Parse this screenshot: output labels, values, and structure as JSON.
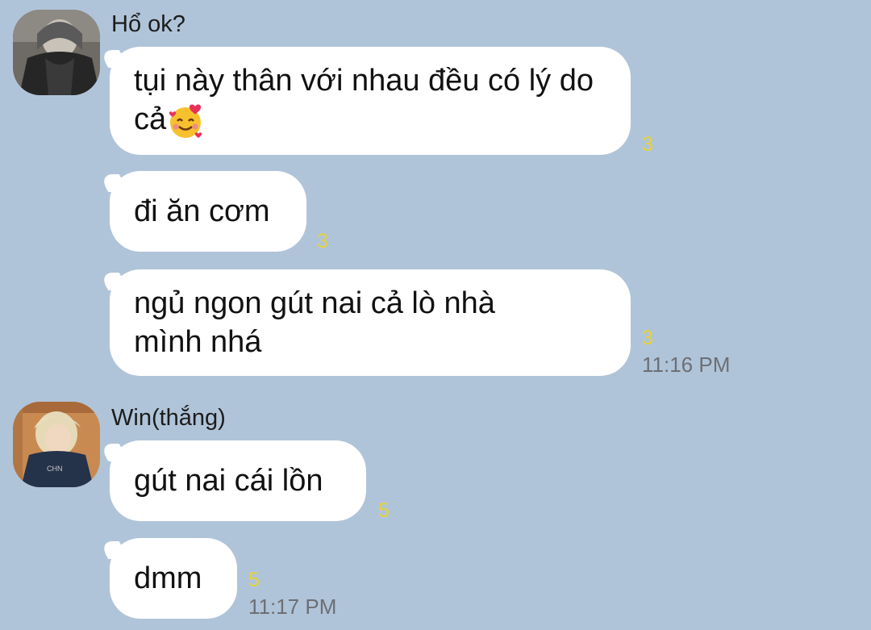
{
  "groups": [
    {
      "sender": "Hổ ok?",
      "messages": [
        {
          "text": "tụi này thân với nhau đều có lý do cả",
          "emoji": "smiling-face-with-hearts-icon",
          "read_count": "3",
          "time": ""
        },
        {
          "text": "đi ăn cơm",
          "read_count": "3",
          "time": ""
        },
        {
          "text": "ngủ ngon gút nai cả lò nhà mình nhá",
          "read_count": "3",
          "time": "11:16 PM"
        }
      ]
    },
    {
      "sender": "Win(thắng)",
      "messages": [
        {
          "text": "gút nai cái lồn",
          "read_count": "5",
          "time": ""
        },
        {
          "text": "dmm",
          "read_count": "5",
          "time": "11:17 PM"
        }
      ]
    }
  ],
  "colors": {
    "background": "#b0c4d9",
    "bubble": "#ffffff",
    "read_count": "#e6d23a",
    "timestamp": "#6c6f75"
  }
}
